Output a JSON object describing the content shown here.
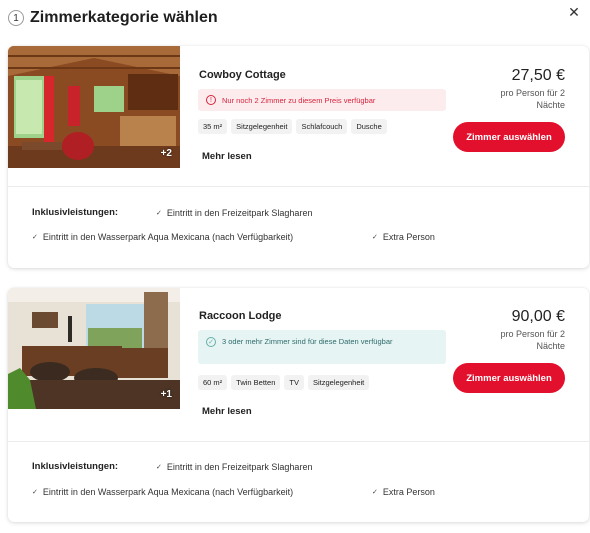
{
  "header": {
    "step": "1",
    "title": "Zimmerkategorie wählen",
    "close": "✕"
  },
  "rooms": [
    {
      "name": "Cowboy Cottage",
      "photo_more": "+2",
      "notice": "Nur noch 2 Zimmer zu diesem Preis verfügbar",
      "notice_type": "warning",
      "features": [
        "35 m²",
        "Sitzgelegenheit",
        "Schlafcouch",
        "Dusche"
      ],
      "more": "Mehr lesen",
      "price": "27,50 €",
      "price_sub": "pro Person für 2 Nächte",
      "button": "Zimmer auswählen",
      "inclusions_label": "Inklusivleistungen:",
      "inclusions": [
        "Eintritt in den Freizeitpark Slagharen",
        "Eintritt in den Wasserpark Aqua Mexicana (nach Verfügbarkeit)",
        "Extra Person"
      ]
    },
    {
      "name": "Raccoon Lodge",
      "photo_more": "+1",
      "notice": "3 oder mehr Zimmer sind für diese Daten verfügbar",
      "notice_type": "success",
      "features": [
        "60 m²",
        "Twin Betten",
        "TV",
        "Sitzgelegenheit"
      ],
      "more": "Mehr lesen",
      "price": "90,00 €",
      "price_sub": "pro Person für 2 Nächte",
      "button": "Zimmer auswählen",
      "inclusions_label": "Inklusivleistungen:",
      "inclusions": [
        "Eintritt in den Freizeitpark Slagharen",
        "Eintritt in den Wasserpark Aqua Mexicana (nach Verfügbarkeit)",
        "Extra Person"
      ]
    }
  ],
  "icons": {
    "warning": "alert-circle-icon",
    "success": "check-circle-icon",
    "inclusion": "check-icon",
    "close": "close-icon"
  },
  "colors": {
    "accent": "#e3102d",
    "warning_bg": "#fdecee",
    "warning_text": "#d6243c",
    "success_bg": "#e6f4f4",
    "success_text": "#2f6b6b"
  }
}
